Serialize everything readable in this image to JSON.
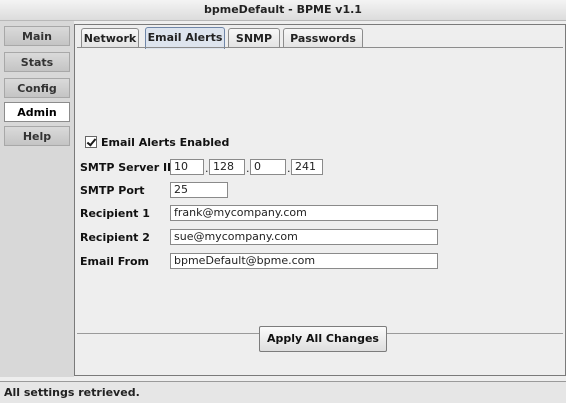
{
  "window": {
    "title": "bpmeDefault - BPME v1.1"
  },
  "sidebar": {
    "items": [
      {
        "label": "Main"
      },
      {
        "label": "Stats"
      },
      {
        "label": "Config"
      },
      {
        "label": "Admin",
        "active": true
      },
      {
        "label": "Help"
      }
    ]
  },
  "tabs": [
    {
      "label": "Network"
    },
    {
      "label": "Email Alerts",
      "active": true
    },
    {
      "label": "SNMP"
    },
    {
      "label": "Passwords"
    }
  ],
  "email_alerts": {
    "enabled_label": "Email Alerts Enabled",
    "enabled": true,
    "smtp_server_ip": {
      "label": "SMTP Server IP",
      "octets": [
        "10",
        "128",
        "0",
        "241"
      ],
      "separator": "."
    },
    "smtp_port": {
      "label": "SMTP Port",
      "value": "25"
    },
    "recipient_1": {
      "label": "Recipient 1",
      "value": "frank@mycompany.com"
    },
    "recipient_2": {
      "label": "Recipient 2",
      "value": "sue@mycompany.com"
    },
    "email_from": {
      "label": "Email From",
      "value": "bpmeDefault@bpme.com"
    }
  },
  "actions": {
    "apply_label": "Apply All Changes"
  },
  "status": {
    "text": "All settings retrieved."
  }
}
